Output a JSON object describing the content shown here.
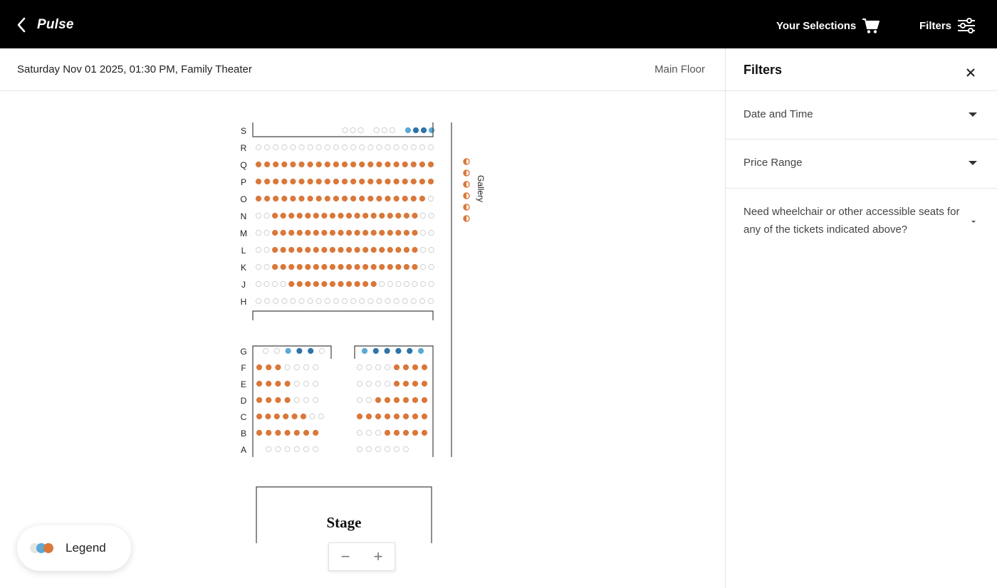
{
  "header": {
    "brand": "Pulse",
    "selections_label": "Your Selections",
    "filters_label": "Filters",
    "icons": {
      "back": "chevron-left-icon",
      "cart": "cart-icon",
      "filters": "sliders-icon"
    }
  },
  "event": {
    "info": "Saturday Nov 01 2025, 01:30 PM, Family Theater",
    "floor": "Main Floor"
  },
  "seatmap": {
    "colors": {
      "available": "#d9783a",
      "accessible_light": "#5aa9d6",
      "accessible_dark": "#2f74a8",
      "unavailable": "#cfcfcf"
    },
    "upper_rows": [
      {
        "label": "S",
        "seats": "-----------uuu-uuu-aAAa"
      },
      {
        "label": "R",
        "seats": "uuuuuuuuuuuuuuuuuuuuu"
      },
      {
        "label": "Q",
        "seats": "ooooooooooooooooooooo"
      },
      {
        "label": "P",
        "seats": "ooooooooooooooooooooo"
      },
      {
        "label": "O",
        "seats": "oooooooooooooooooooou"
      },
      {
        "label": "N",
        "seats": "uuoooooooooooooooooouu"
      },
      {
        "label": "M",
        "seats": "uuoooooooooooooooooouu"
      },
      {
        "label": "L",
        "seats": "uuoooooooooooooooooouu"
      },
      {
        "label": "K",
        "seats": "uuoooooooooooooooooouu"
      },
      {
        "label": "J",
        "seats": "uuuuooooooooooouuuuuuu"
      },
      {
        "label": "H",
        "seats": "uuuuuuuuuuuuuuuuuuuuu"
      }
    ],
    "lower_rows": [
      {
        "label": "G",
        "left": "uuaAAu",
        "right": "aAAAAa"
      },
      {
        "label": "F",
        "left": "ooouuuu",
        "right": "uuuuoooo"
      },
      {
        "label": "E",
        "left": "oooouuu",
        "right": "uuuuoooo"
      },
      {
        "label": "D",
        "left": "oooouuu",
        "right": "uuoooooo"
      },
      {
        "label": "C",
        "left": "oooooouu",
        "right": "oooooooo"
      },
      {
        "label": "B",
        "left": "ooooooo",
        "right": "uuuooooo"
      },
      {
        "label": "A",
        "left": "-uuuuuu",
        "right": "uuuuuu"
      }
    ],
    "gallery_label": "Gallery",
    "gallery_seats": 6,
    "stage_label": "Stage"
  },
  "zoom": {
    "minus": "−",
    "plus": "+"
  },
  "legend": {
    "label": "Legend"
  },
  "filters_panel": {
    "title": "Filters",
    "close_icon": "close-icon",
    "sections": [
      {
        "label": "Date and Time"
      },
      {
        "label": "Price Range"
      },
      {
        "label": "Need wheelchair or other accessible seats for any of the tickets indicated above?"
      }
    ]
  }
}
